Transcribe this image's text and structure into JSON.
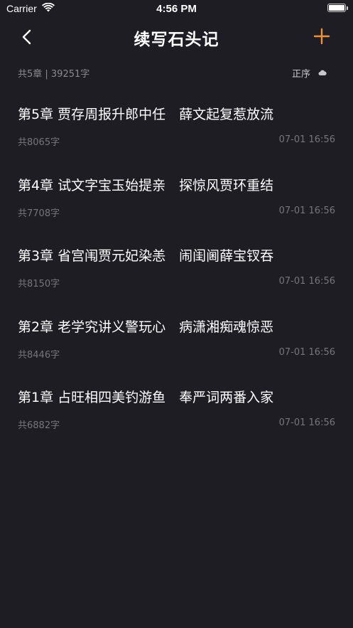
{
  "status_bar": {
    "carrier": "Carrier",
    "time": "4:56 PM",
    "wifi_icon": "wifi-icon",
    "battery_icon": "battery-icon",
    "battery_level": 1.0
  },
  "nav": {
    "title": "续写石头记",
    "back_icon": "chevron-left-icon",
    "add_icon": "plus-icon",
    "accent_color": "#f0913a"
  },
  "summary": {
    "text": "共5章 | 39251字",
    "sort_label": "正序",
    "sort_icon": "cloud-icon"
  },
  "chapters": [
    {
      "title": "第5章 贾存周报升郎中任　薛文起复惹放流",
      "count": "共8065字",
      "time": "07-01 16:56"
    },
    {
      "title": "第4章 试文字宝玉始提亲　探惊风贾环重结",
      "count": "共7708字",
      "time": "07-01 16:56"
    },
    {
      "title": "第3章 省宫闱贾元妃染恙　闹闺阃薛宝钗吞",
      "count": "共8150字",
      "time": "07-01 16:56"
    },
    {
      "title": "第2章 老学究讲义警玩心　病潇湘痴魂惊恶",
      "count": "共8446字",
      "time": "07-01 16:56"
    },
    {
      "title": "第1章 占旺相四美钓游鱼　奉严词两番入家",
      "count": "共6882字",
      "time": "07-01 16:56"
    }
  ]
}
